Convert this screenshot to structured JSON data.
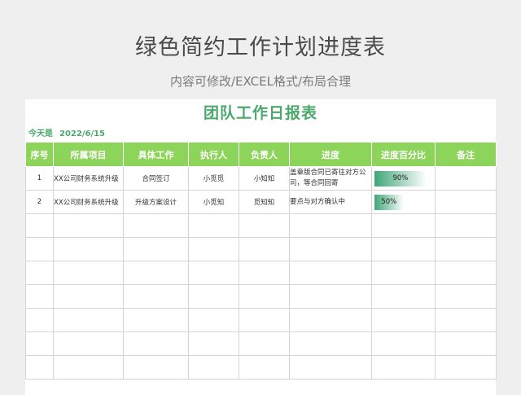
{
  "page": {
    "title": "绿色简约工作计划进度表",
    "subtitle": "内容可修改/EXCEL格式/布局合理"
  },
  "sheet": {
    "title": "团队工作日报表",
    "date_label": "今天是",
    "date_value": "2022/6/15",
    "headers": [
      "序号",
      "所属项目",
      "具体工作",
      "执行人",
      "负责人",
      "进度",
      "进度百分比",
      "备注"
    ],
    "rows": [
      {
        "no": "1",
        "project": "XX公司财务系统升级",
        "task": "合同签订",
        "executor": "小觅觅",
        "owner": "小知知",
        "progress": "盖章版合同已寄往对方公司，等合同回寄",
        "percent_label": "90%",
        "percent": 0.9,
        "note": ""
      },
      {
        "no": "2",
        "project": "XX公司财务系统升级",
        "task": "升级方案设计",
        "executor": "小觅知",
        "owner": "觅知知",
        "progress": "要点与对方确认中",
        "percent_label": "50%",
        "percent": 0.5,
        "note": ""
      }
    ],
    "empty_row_count": 7,
    "colors": {
      "header_bg": "#8cd45a",
      "title_green": "#4aa86b",
      "bar_green": "#3fa678"
    }
  }
}
